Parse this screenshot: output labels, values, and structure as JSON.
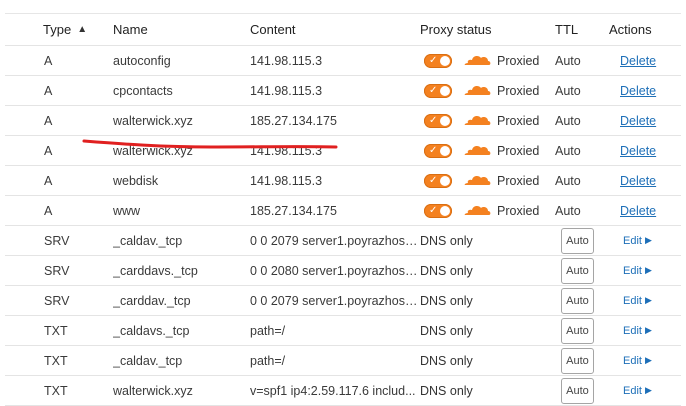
{
  "header": {
    "type": "Type",
    "name": "Name",
    "content": "Content",
    "proxy_status": "Proxy status",
    "ttl": "TTL",
    "actions": "Actions"
  },
  "rows": [
    {
      "type": "A",
      "name": "autoconfig",
      "content": "141.98.115.3",
      "mode": "proxied",
      "status": "Proxied",
      "ttl": "Auto",
      "action": "Delete"
    },
    {
      "type": "A",
      "name": "cpcontacts",
      "content": "141.98.115.3",
      "mode": "proxied",
      "status": "Proxied",
      "ttl": "Auto",
      "action": "Delete"
    },
    {
      "type": "A",
      "name": "walterwick.xyz",
      "content": "185.27.134.175",
      "mode": "proxied",
      "status": "Proxied",
      "ttl": "Auto",
      "action": "Delete"
    },
    {
      "type": "A",
      "name": "walterwick.xyz",
      "content": "141.98.115.3",
      "mode": "proxied",
      "status": "Proxied",
      "ttl": "Auto",
      "action": "Delete"
    },
    {
      "type": "A",
      "name": "webdisk",
      "content": "141.98.115.3",
      "mode": "proxied",
      "status": "Proxied",
      "ttl": "Auto",
      "action": "Delete"
    },
    {
      "type": "A",
      "name": "www",
      "content": "185.27.134.175",
      "mode": "proxied",
      "status": "Proxied",
      "ttl": "Auto",
      "action": "Delete"
    },
    {
      "type": "SRV",
      "name": "_caldav._tcp",
      "content": "0 0 2079 server1.poyrazhost...",
      "mode": "dns",
      "status": "DNS only",
      "ttl": "Auto",
      "action": "Edit"
    },
    {
      "type": "SRV",
      "name": "_carddavs._tcp",
      "content": "0 0 2080 server1.poyrazhost...",
      "mode": "dns",
      "status": "DNS only",
      "ttl": "Auto",
      "action": "Edit"
    },
    {
      "type": "SRV",
      "name": "_carddav._tcp",
      "content": "0 0 2079 server1.poyrazhost...",
      "mode": "dns",
      "status": "DNS only",
      "ttl": "Auto",
      "action": "Edit"
    },
    {
      "type": "TXT",
      "name": "_caldavs._tcp",
      "content": "path=/",
      "mode": "dns",
      "status": "DNS only",
      "ttl": "Auto",
      "action": "Edit"
    },
    {
      "type": "TXT",
      "name": "_caldav._tcp",
      "content": "path=/",
      "mode": "dns",
      "status": "DNS only",
      "ttl": "Auto",
      "action": "Edit"
    },
    {
      "type": "TXT",
      "name": "walterwick.xyz",
      "content": "v=spf1 ip4:2.59.117.6 includ...",
      "mode": "dns",
      "status": "DNS only",
      "ttl": "Auto",
      "action": "Edit"
    }
  ],
  "colors": {
    "accent_orange": "#f48120",
    "link_blue": "#1d6fb8",
    "redaction_red": "#e02020"
  },
  "icons": {
    "sort": "sort-up-icon",
    "proxy": "cloud-icon",
    "edit": "triangle-right-icon"
  }
}
